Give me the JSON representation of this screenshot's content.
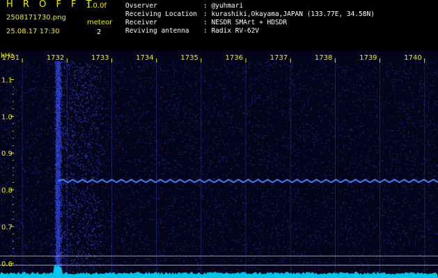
{
  "header": {
    "app_title": "H R O F F T",
    "version": "1.0.0f",
    "filename": "250817173­0.png",
    "timestamp": "25.08.17 17:30",
    "mode": "meteor",
    "count": "2",
    "meta": [
      {
        "label": "Ovserver",
        "value": ": @yuhmari"
      },
      {
        "label": "Receiving Location",
        "value": ": kurashiki,Okayama,JAPAN (133.77E, 34.58N)"
      },
      {
        "label": "Receiver",
        "value": ": NESDR SMArt + HDSDR"
      },
      {
        "label": "Reviving antenna",
        "value": ": Radix RV-62V"
      }
    ]
  },
  "colors": {
    "label": "#f0f000",
    "text": "#ffffff",
    "background": "#000000",
    "spectrum_trace": "#00e5ff",
    "signal": "#3a6bff"
  },
  "chart_data": {
    "type": "heatmap",
    "xlabel": "",
    "ylabel": "kHz",
    "x_ticks": [
      "1731",
      "1732",
      "1733",
      "1734",
      "1735",
      "1736",
      "1737",
      "1738",
      "1739",
      "1740"
    ],
    "y_ticks": [
      {
        "value": 1.1,
        "label": "1.1"
      },
      {
        "value": 1.0,
        "label": "1.0"
      },
      {
        "value": 0.9,
        "label": "0.9"
      },
      {
        "value": 0.8,
        "label": "0.8"
      },
      {
        "value": 0.7,
        "label": "0.7"
      },
      {
        "value": 0.6,
        "label": "0.6"
      }
    ],
    "xlim": [
      1730.5,
      1740.3
    ],
    "ylim": [
      0.56,
      1.15
    ],
    "signal_freq_khz": 0.824,
    "meteor_time": 1731.8,
    "reference_lines_khz": [
      0.62,
      0.595
    ]
  }
}
